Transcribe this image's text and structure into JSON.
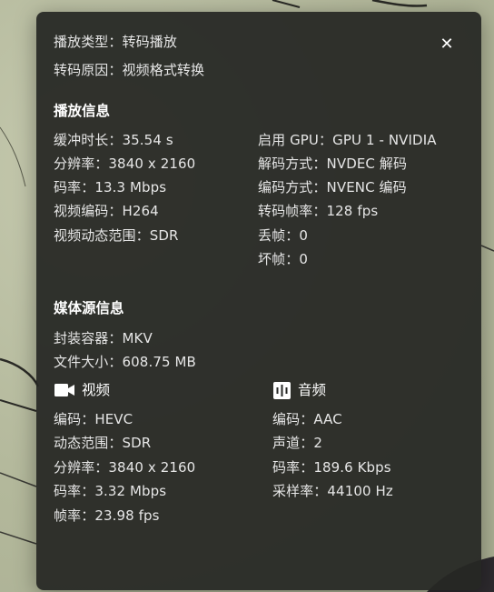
{
  "overlay": {
    "close_icon": "close-icon",
    "summary": {
      "play_type_label": "播放类型：",
      "play_type_value": "转码播放",
      "transcode_reason_label": "转码原因：",
      "transcode_reason_value": "视频格式转换"
    },
    "playback_info": {
      "heading": "播放信息",
      "left": [
        {
          "label": "缓冲时长：",
          "value": "35.54 s"
        },
        {
          "label": "分辨率：",
          "value": "3840 x 2160"
        },
        {
          "label": "码率：",
          "value": "13.3 Mbps"
        },
        {
          "label": "视频编码：",
          "value": "H264"
        },
        {
          "label": "视频动态范围：",
          "value": "SDR"
        }
      ],
      "right": [
        {
          "label": "启用 GPU：",
          "value": "GPU 1 - NVIDIA"
        },
        {
          "label": "解码方式：",
          "value": "NVDEC 解码"
        },
        {
          "label": "编码方式：",
          "value": "NVENC 编码"
        },
        {
          "label": "转码帧率：",
          "value": "128 fps"
        },
        {
          "label": "丢帧：",
          "value": "0"
        },
        {
          "label": "坏帧：",
          "value": "0"
        }
      ]
    },
    "media_source_info": {
      "heading": "媒体源信息",
      "container_label": "封装容器：",
      "container_value": "MKV",
      "file_size_label": "文件大小：",
      "file_size_value": "608.75 MB",
      "video": {
        "icon": "video-camera-icon",
        "heading": "视频",
        "rows": [
          {
            "label": "编码：",
            "value": "HEVC"
          },
          {
            "label": "动态范围：",
            "value": "SDR"
          },
          {
            "label": "分辨率：",
            "value": "3840 x 2160"
          },
          {
            "label": "码率：",
            "value": "3.32 Mbps"
          },
          {
            "label": "帧率：",
            "value": "23.98 fps"
          }
        ]
      },
      "audio": {
        "icon": "audio-wave-icon",
        "heading": "音频",
        "rows": [
          {
            "label": "编码：",
            "value": "AAC"
          },
          {
            "label": "声道：",
            "value": "2"
          },
          {
            "label": "码率：",
            "value": "189.6 Kbps"
          },
          {
            "label": "采样率：",
            "value": "44100 Hz"
          }
        ]
      }
    }
  },
  "colors": {
    "panel_bg": "#262724",
    "text": "#e6e6e6",
    "heading": "#ffffff"
  }
}
